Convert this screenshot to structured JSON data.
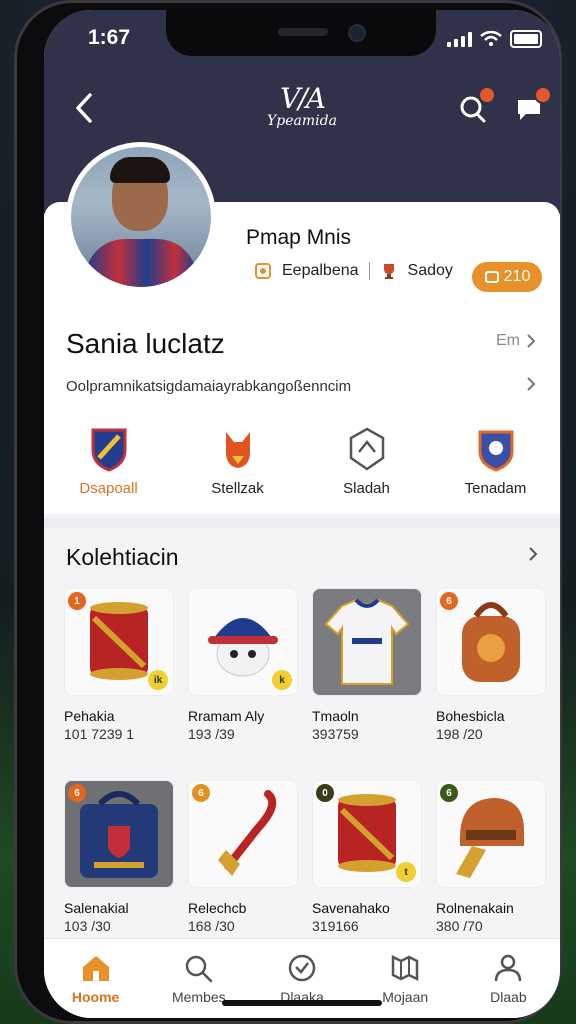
{
  "status": {
    "time": "1:67"
  },
  "header": {
    "logo_mark": "V/A",
    "logo_word": "Ypeamida"
  },
  "profile": {
    "name": "Pmap Mnis",
    "meta1": "Eepalbena",
    "meta2": "Sadoy",
    "points": "210"
  },
  "section": {
    "title": "Sania luclatz",
    "see_more": "Em",
    "subtitle": "Oolpramnikatsigdamaiayrabkangoßenncim"
  },
  "categories": [
    {
      "label": "Dsapoall",
      "icon": "shield-crest-icon",
      "active": true
    },
    {
      "label": "Stellzak",
      "icon": "fox-mascot-icon",
      "active": false
    },
    {
      "label": "Sladah",
      "icon": "stadium-badge-icon",
      "active": false
    },
    {
      "label": "Tenadam",
      "icon": "team-crest-icon",
      "active": false
    }
  ],
  "collection": {
    "title": "Kolehtiacin",
    "items": [
      {
        "name": "Pehakia",
        "sub": "101 7239 1",
        "rank": "1",
        "rank_color": "#e2681f",
        "tag": "ik",
        "icon": "drum-icon"
      },
      {
        "name": "Rramam Aly",
        "sub": "193 /39",
        "rank": "",
        "rank_color": "",
        "tag": "k",
        "icon": "cap-mascot-icon"
      },
      {
        "name": "Tmaoln",
        "sub": "393759",
        "rank": "",
        "rank_color": "",
        "tag": "",
        "icon": "jersey-icon"
      },
      {
        "name": "Bohesbicla",
        "sub": "198 /20",
        "rank": "6",
        "rank_color": "#e2681f",
        "tag": "",
        "icon": "backpack-icon"
      },
      {
        "name": "Salenakial",
        "sub": "103 /30",
        "rank": "6",
        "rank_color": "#e2681f",
        "tag": "",
        "icon": "bag-icon"
      },
      {
        "name": "Relechcb",
        "sub": "168 /30",
        "rank": "6",
        "rank_color": "#e2901f",
        "tag": "",
        "icon": "lanyard-icon"
      },
      {
        "name": "Savenahako",
        "sub": "319166",
        "rank": "0",
        "rank_color": "#3b3b1a",
        "tag": "t",
        "icon": "drum-icon"
      },
      {
        "name": "Rolnenakain",
        "sub": "380 /70",
        "rank": "6",
        "rank_color": "#3a5a1a",
        "tag": "",
        "icon": "helmet-icon"
      }
    ]
  },
  "tabs": [
    {
      "label": "Hoome",
      "icon": "home-icon",
      "active": true
    },
    {
      "label": "Membes",
      "icon": "search-icon",
      "active": false
    },
    {
      "label": "Dlaaka",
      "icon": "check-circle-icon",
      "active": false
    },
    {
      "label": "Mojaan",
      "icon": "map-icon",
      "active": false
    },
    {
      "label": "Dlaab",
      "icon": "person-icon",
      "active": false
    }
  ],
  "colors": {
    "accent": "#e8902a",
    "header": "#2f3248"
  }
}
